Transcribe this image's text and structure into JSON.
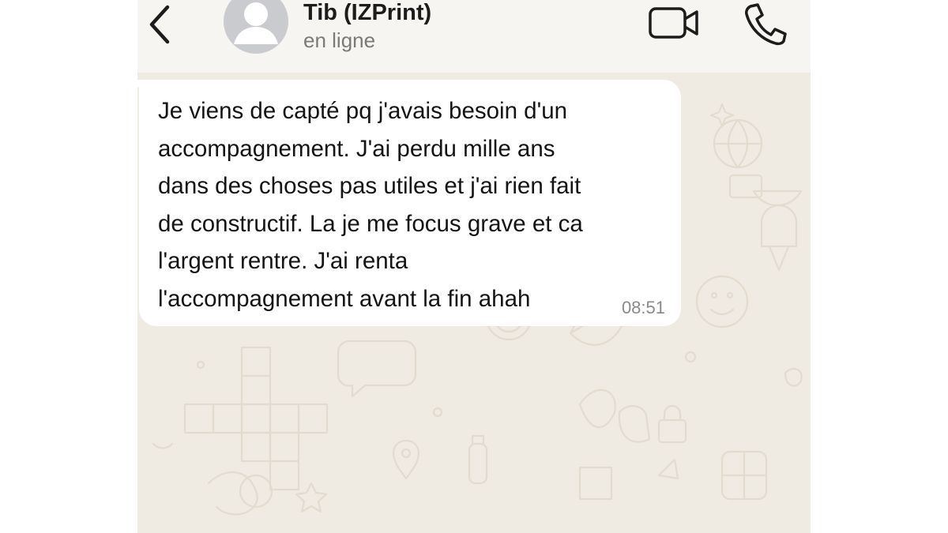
{
  "header": {
    "back_icon": "chevron-left-icon",
    "avatar_icon": "person-silhouette-icon",
    "contact_name": "Tib (IZPrint)",
    "status": "en ligne",
    "video_icon": "video-camera-icon",
    "call_icon": "phone-icon"
  },
  "message": {
    "lines": [
      "Je viens de capté pq j'avais besoin d'un",
      "accompagnement. J'ai perdu mille ans",
      "dans des choses pas utiles et j'ai rien fait",
      "de constructif. La je me focus grave et ca",
      "l'argent rentre. J'ai renta",
      "l'accompagnement avant la fin ahah"
    ],
    "time": "08:51"
  },
  "colors": {
    "chat_background": "#efeae2",
    "header_background": "#f7f5f1",
    "bubble": "#ffffff",
    "icon_stroke": "#1c1c1c"
  }
}
